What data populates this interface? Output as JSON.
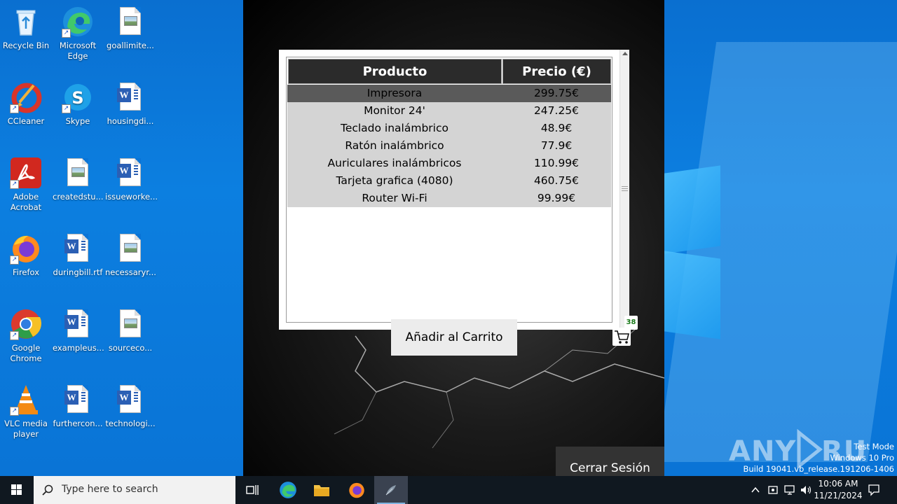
{
  "desktop": {
    "icons": [
      {
        "label": "Recycle Bin",
        "icon": "recycle-bin-icon"
      },
      {
        "label": "Microsoft Edge",
        "icon": "edge-icon"
      },
      {
        "label": "goallimite...",
        "icon": "image-file-icon"
      },
      {
        "label": "CCleaner",
        "icon": "ccleaner-icon"
      },
      {
        "label": "Skype",
        "icon": "skype-icon"
      },
      {
        "label": "housingdi...",
        "icon": "word-doc-icon"
      },
      {
        "label": "Adobe Acrobat",
        "icon": "acrobat-icon"
      },
      {
        "label": "createdstu...",
        "icon": "image-file-icon"
      },
      {
        "label": "issueworke...",
        "icon": "word-doc-icon"
      },
      {
        "label": "Firefox",
        "icon": "firefox-icon"
      },
      {
        "label": "duringbill.rtf",
        "icon": "word-doc-icon"
      },
      {
        "label": "necessaryr...",
        "icon": "image-file-icon"
      },
      {
        "label": "Google Chrome",
        "icon": "chrome-icon"
      },
      {
        "label": "exampleus...",
        "icon": "word-doc-icon"
      },
      {
        "label": "sourceco...",
        "icon": "image-file-icon"
      },
      {
        "label": "VLC media player",
        "icon": "vlc-icon"
      },
      {
        "label": "furthercon...",
        "icon": "word-doc-icon"
      },
      {
        "label": "technologi...",
        "icon": "word-doc-icon"
      }
    ]
  },
  "app": {
    "table": {
      "headers": {
        "product": "Producto",
        "price": "Precio (€)"
      },
      "rows": [
        {
          "name": "Impresora",
          "price": "299.75€",
          "selected": true
        },
        {
          "name": "Monitor 24'",
          "price": "247.25€",
          "selected": false
        },
        {
          "name": "Teclado inalámbrico",
          "price": "48.9€",
          "selected": false
        },
        {
          "name": "Ratón inalámbrico",
          "price": "77.9€",
          "selected": false
        },
        {
          "name": "Auriculares inalámbricos",
          "price": "110.99€",
          "selected": false
        },
        {
          "name": "Tarjeta grafica (4080)",
          "price": "460.75€",
          "selected": false
        },
        {
          "name": "Router Wi-Fi",
          "price": "99.99€",
          "selected": false
        }
      ]
    },
    "add_to_cart_label": "Añadir al Carrito",
    "cart_count": "38",
    "logout_label": "Cerrar Sesión"
  },
  "watermark": {
    "text": "ANY RUN",
    "test_mode": "Test Mode",
    "edition": "Windows 10 Pro",
    "build": "Build 19041.vb_release.191206-1406"
  },
  "taskbar": {
    "search_placeholder": "Type here to search",
    "clock_time": "10:06 AM",
    "clock_date": "11/21/2024"
  },
  "colors": {
    "desktop_blue": "#0a74d6",
    "taskbar": "#101820",
    "table_header": "#2b2b2b",
    "row_bg": "#d4d4d4",
    "row_selected": "#5a5a5a",
    "cart_badge_text": "#1a7a1a"
  }
}
